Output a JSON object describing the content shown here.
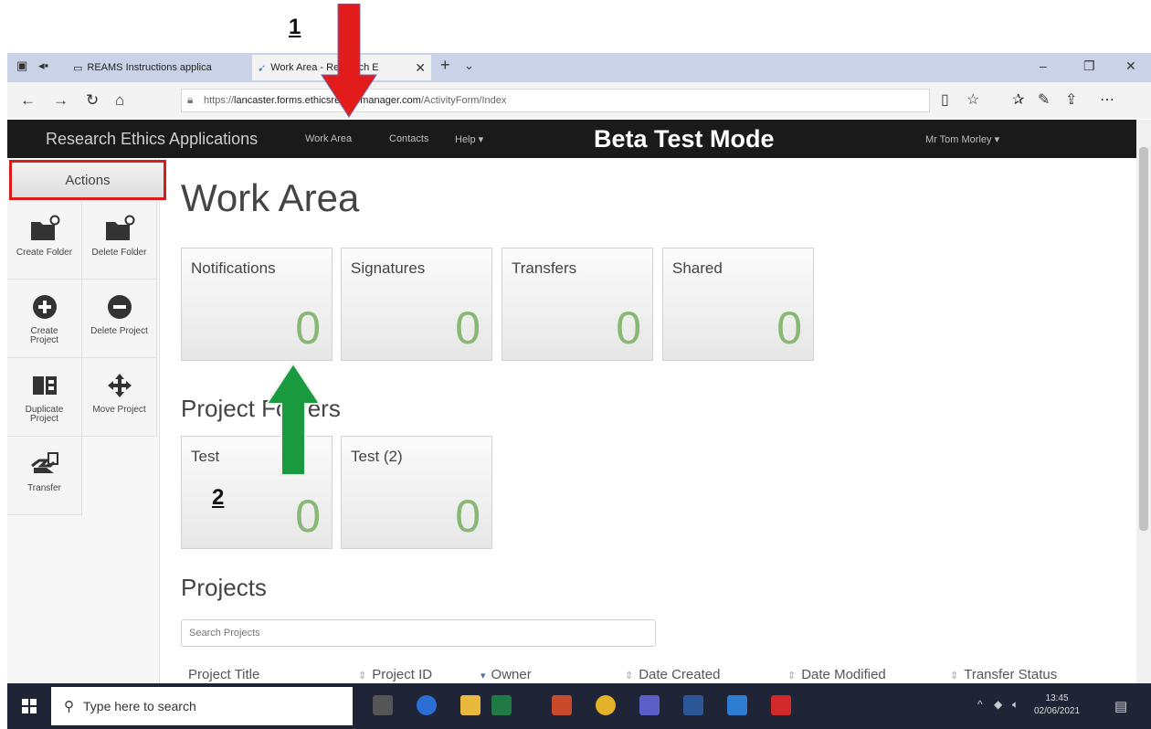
{
  "browser": {
    "tabs": [
      {
        "label": "REAMS Instructions applica",
        "active": false
      },
      {
        "label": "Work Area - Research E",
        "active": true
      }
    ],
    "url_prefix": "https://",
    "url_host": "lancaster.forms.ethicsreviewmanager.com",
    "url_path": "/ActivityForm/Index"
  },
  "appbar": {
    "brand": "Research Ethics Applications",
    "links": [
      "Work Area",
      "Contacts",
      "Help ▾"
    ],
    "beta_label": "Beta Test Mode",
    "user": "Mr Tom Morley ▾"
  },
  "sidebar": {
    "actions_label": "Actions",
    "tiles": [
      {
        "label": "Create Folder",
        "icon": "folder-add-icon"
      },
      {
        "label": "Delete Folder",
        "icon": "folder-delete-icon"
      },
      {
        "label": "Create Project",
        "icon": "plus-circle-icon"
      },
      {
        "label": "Delete Project",
        "icon": "minus-circle-icon"
      },
      {
        "label": "Duplicate Project",
        "icon": "duplicate-icon"
      },
      {
        "label": "Move Project",
        "icon": "move-icon"
      },
      {
        "label": "Transfer",
        "icon": "transfer-icon"
      }
    ]
  },
  "main": {
    "title": "Work Area",
    "summary_cards": [
      {
        "label": "Notifications",
        "value": "0"
      },
      {
        "label": "Signatures",
        "value": "0"
      },
      {
        "label": "Transfers",
        "value": "0"
      },
      {
        "label": "Shared",
        "value": "0"
      }
    ],
    "folders_heading": "Project Folders",
    "folders": [
      {
        "label": "Test",
        "value": "0"
      },
      {
        "label": "Test (2)",
        "value": "0"
      }
    ],
    "projects_heading": "Projects",
    "search_placeholder": "Search Projects",
    "columns": [
      "Project Title",
      "Project ID",
      "Owner",
      "Date Created",
      "Date Modified",
      "Transfer Status"
    ]
  },
  "taskbar": {
    "search_placeholder": "Type here to search",
    "time": "13:45",
    "date": "02/06/2021"
  },
  "annotations": {
    "marker_1": "1",
    "marker_2": "2",
    "red_arrow_color": "#e21b1b",
    "green_arrow_color": "#1a9a3f"
  }
}
